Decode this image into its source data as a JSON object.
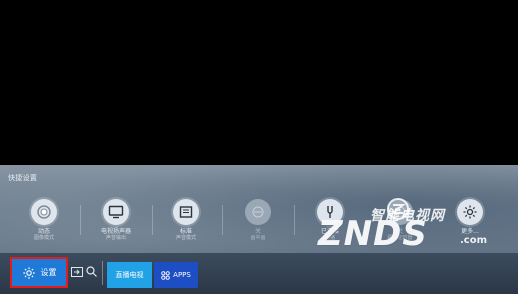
{
  "quick_settings": {
    "title": "快捷设置",
    "items": [
      {
        "label": "动态",
        "sub": "图像模式",
        "icon": "picture-mode-icon",
        "enabled": true
      },
      {
        "label": "电视扬声器",
        "sub": "声音输出",
        "icon": "tv-speaker-icon",
        "enabled": true
      },
      {
        "label": "标准",
        "sub": "声音模式",
        "icon": "sound-mode-icon",
        "enabled": true
      },
      {
        "label": "关",
        "sub": "画中画",
        "icon": "pip-icon",
        "enabled": false
      },
      {
        "label": "已连接",
        "sub": "网络",
        "icon": "network-icon",
        "enabled": true
      },
      {
        "label": "关",
        "sub": "睡眠定时器",
        "icon": "sleep-timer-icon",
        "enabled": false
      },
      {
        "label": "更多...",
        "sub": "",
        "icon": "more-settings-icon",
        "enabled": true
      }
    ]
  },
  "watermark": {
    "top_text": "智能电视网",
    "main_text": "ZNDS",
    "suffix": ".com"
  },
  "bottom_bar": {
    "settings_label": "设置",
    "source_icon": "source-input-icon",
    "search_icon": "search-icon",
    "tiles": [
      {
        "label": "直播电视",
        "color": "#22a2e6"
      },
      {
        "label": "APPS",
        "color": "#1e4ec4"
      }
    ]
  },
  "colors": {
    "focus_border": "#e21b1b",
    "settings_bg": "#1f79d6"
  }
}
